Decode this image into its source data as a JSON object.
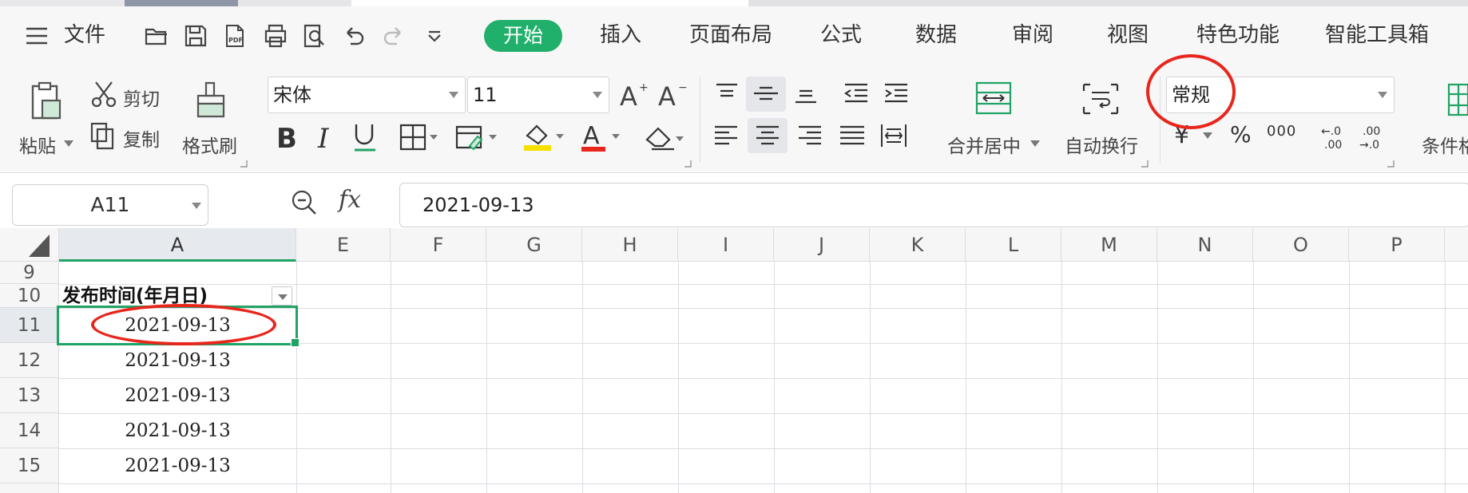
{
  "menu": {
    "file_label": "文件",
    "tabs": [
      "开始",
      "插入",
      "页面布局",
      "公式",
      "数据",
      "审阅",
      "视图",
      "特色功能",
      "智能工具箱"
    ]
  },
  "ribbon": {
    "paste_label": "粘贴",
    "cut_label": "剪切",
    "copy_label": "复制",
    "format_painter_label": "格式刷",
    "font_name": "宋体",
    "font_size": "11",
    "merge_center_label": "合并居中",
    "wrap_text_label": "自动换行",
    "number_format": "常规",
    "currency_symbol": "¥",
    "percent_symbol": "%",
    "thousands_symbol": "000",
    "conditional_label": "条件格"
  },
  "formula_bar": {
    "name_box": "A11",
    "fx_label": "fx",
    "formula": "2021-09-13"
  },
  "sheet": {
    "columns": [
      "A",
      "E",
      "F",
      "G",
      "H",
      "I",
      "J",
      "K",
      "L",
      "M",
      "N",
      "O",
      "P"
    ],
    "rows": [
      "9",
      "10",
      "11",
      "12",
      "13",
      "14",
      "15"
    ],
    "header_cell": "发布时间(年月日)",
    "values": [
      "2021-09-13",
      "2021-09-13",
      "2021-09-13",
      "2021-09-13",
      "2021-09-13"
    ]
  },
  "colors": {
    "accent": "#21b06b",
    "selection": "#21a366",
    "annotation": "#e8261c"
  }
}
